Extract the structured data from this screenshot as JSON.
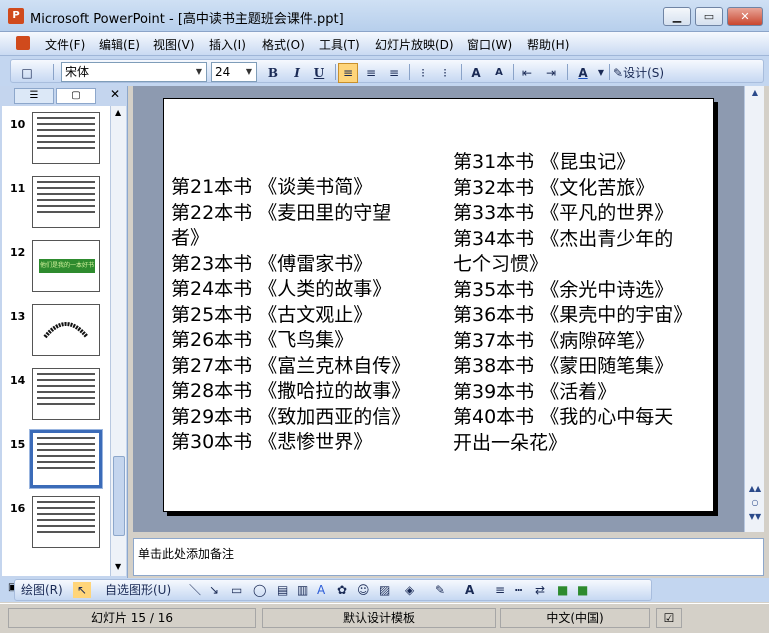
{
  "window": {
    "title": "Microsoft PowerPoint - [高中读书主题班会课件.ppt]",
    "minimize_label": "▁",
    "maximize_label": "▭",
    "close_label": "✕"
  },
  "menu": [
    "文件(F)",
    "编辑(E)",
    "视图(V)",
    "插入(I)",
    "格式(O)",
    "工具(T)",
    "幻灯片放映(D)",
    "窗口(W)",
    "帮助(H)"
  ],
  "toolbar": {
    "font_name": "宋体",
    "font_size": "24",
    "bold": "B",
    "italic": "I",
    "underline": "U",
    "design_label": "设计(S)"
  },
  "thumbnails": [
    {
      "num": "10",
      "type": "text"
    },
    {
      "num": "11",
      "type": "text"
    },
    {
      "num": "12",
      "type": "banner",
      "banner": "他们是我的一本好书"
    },
    {
      "num": "13",
      "type": "arc"
    },
    {
      "num": "14",
      "type": "text"
    },
    {
      "num": "15",
      "type": "text",
      "selected": true
    },
    {
      "num": "16",
      "type": "text"
    }
  ],
  "slide": {
    "left_column": [
      "第21本书 《谈美书简》",
      "第22本书 《麦田里的守望",
      "者》",
      "第23本书 《傅雷家书》",
      "第24本书 《人类的故事》",
      "第25本书 《古文观止》",
      "第26本书 《飞鸟集》",
      "第27本书 《富兰克林自传》",
      "第28本书 《撒哈拉的故事》",
      "第29本书 《致加西亚的信》",
      "第30本书 《悲惨世界》"
    ],
    "right_column": [
      "第31本书 《昆虫记》",
      "第32本书 《文化苦旅》",
      "第33本书 《平凡的世界》",
      "第34本书 《杰出青少年的",
      "七个习惯》",
      "第35本书 《余光中诗选》",
      "第36本书 《果壳中的宇宙》",
      "第37本书 《病隙碎笔》",
      "第38本书 《蒙田随笔集》",
      "第39本书 《活着》",
      "第40本书 《我的心中每天",
      "开出一朵花》"
    ]
  },
  "notes_placeholder": "单击此处添加备注",
  "drawing_toolbar": {
    "draw_label": "绘图(R)",
    "autoshapes_label": "自选图形(U)"
  },
  "status": {
    "slide_info": "幻灯片 15 / 16",
    "template": "默认设计模板",
    "language": "中文(中国)"
  }
}
